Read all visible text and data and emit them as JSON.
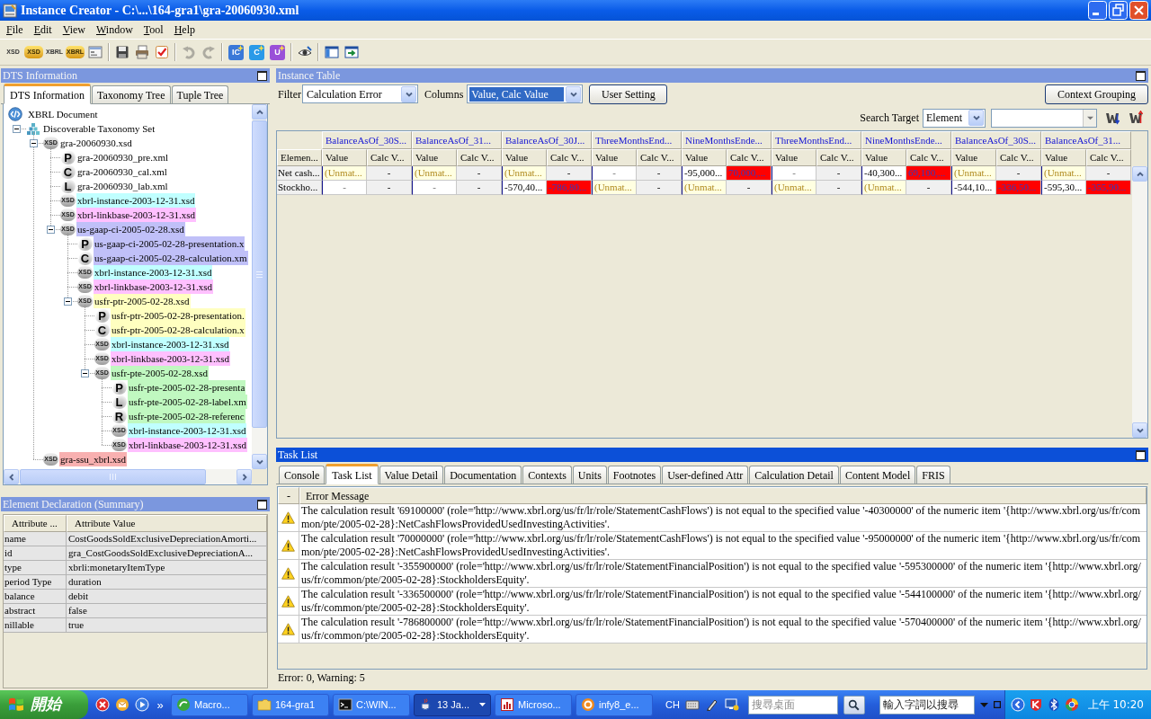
{
  "window": {
    "title": "Instance Creator - C:\\...\\164-gra1\\gra-20060930.xml"
  },
  "menu": [
    "File",
    "Edit",
    "View",
    "Window",
    "Tool",
    "Help"
  ],
  "toolbar": [
    {
      "kind": "text",
      "label": "XSD",
      "highlight": false,
      "disabled": false
    },
    {
      "kind": "text",
      "label": "XSD",
      "highlight": true,
      "disabled": false
    },
    {
      "kind": "text",
      "label": "XBRL",
      "highlight": false,
      "disabled": false
    },
    {
      "kind": "text",
      "label": "XBRL",
      "highlight": true,
      "disabled": false
    },
    {
      "kind": "icon",
      "disabled": false
    },
    {
      "kind": "separator"
    },
    {
      "kind": "icon",
      "disabled": false
    },
    {
      "kind": "icon",
      "disabled": false
    },
    {
      "kind": "icon",
      "disabled": false
    },
    {
      "kind": "separator"
    },
    {
      "kind": "icon",
      "disabled": true
    },
    {
      "kind": "icon",
      "disabled": true
    },
    {
      "kind": "separator"
    },
    {
      "kind": "tile",
      "label": "IC",
      "color": "#3a78d8",
      "disabled": false
    },
    {
      "kind": "tile",
      "label": "C",
      "color": "#2a9ae8",
      "disabled": false
    },
    {
      "kind": "tile",
      "label": "U",
      "color": "#9a50d8",
      "disabled": false
    },
    {
      "kind": "separator"
    },
    {
      "kind": "icon",
      "disabled": false
    },
    {
      "kind": "separator"
    },
    {
      "kind": "icon",
      "disabled": false
    },
    {
      "kind": "icon",
      "disabled": false
    }
  ],
  "dts_panel": {
    "title": "DTS Information",
    "active": false,
    "tabs": [
      {
        "label": "DTS Information",
        "selected": true
      },
      {
        "label": "Taxonomy Tree",
        "selected": false
      },
      {
        "label": "Tuple Tree",
        "selected": false
      }
    ],
    "tree": [
      {
        "label": "XBRL Document",
        "kind": "document",
        "children": [
          {
            "label": "Discoverable Taxonomy Set",
            "kind": "taxonomy",
            "expanded": true,
            "children": [
              {
                "label": "gra-20060930.xsd",
                "kind": "xsd",
                "badge": "XSD",
                "expanded": true,
                "children": [
                  {
                    "label": "gra-20060930_pre.xml",
                    "kind": "linkbase",
                    "badge": "P"
                  },
                  {
                    "label": "gra-20060930_cal.xml",
                    "kind": "linkbase",
                    "badge": "C"
                  },
                  {
                    "label": "gra-20060930_lab.xml",
                    "kind": "linkbase",
                    "badge": "L"
                  },
                  {
                    "label": "xbrl-instance-2003-12-31.xsd",
                    "kind": "xsd",
                    "badge": "XSD",
                    "color": "#c0ffff"
                  },
                  {
                    "label": "xbrl-linkbase-2003-12-31.xsd",
                    "kind": "xsd",
                    "badge": "XSD",
                    "color": "#ffc0ff"
                  },
                  {
                    "label": "us-gaap-ci-2005-02-28.xsd",
                    "kind": "xsd",
                    "badge": "XSD",
                    "color": "#c0c0f8",
                    "expanded": true,
                    "children": [
                      {
                        "label": "us-gaap-ci-2005-02-28-presentation.x",
                        "kind": "linkbase",
                        "badge": "P",
                        "color": "#c0c0f8"
                      },
                      {
                        "label": "us-gaap-ci-2005-02-28-calculation.xm",
                        "kind": "linkbase",
                        "badge": "C",
                        "color": "#c0c0f8"
                      },
                      {
                        "label": "xbrl-instance-2003-12-31.xsd",
                        "kind": "xsd",
                        "badge": "XSD",
                        "color": "#c0ffff"
                      },
                      {
                        "label": "xbrl-linkbase-2003-12-31.xsd",
                        "kind": "xsd",
                        "badge": "XSD",
                        "color": "#ffc0ff"
                      },
                      {
                        "label": "usfr-ptr-2005-02-28.xsd",
                        "kind": "xsd",
                        "badge": "XSD",
                        "color": "#ffffc0",
                        "expanded": true,
                        "children": [
                          {
                            "label": "usfr-ptr-2005-02-28-presentation.",
                            "kind": "linkbase",
                            "badge": "P",
                            "color": "#ffffc0"
                          },
                          {
                            "label": "usfr-ptr-2005-02-28-calculation.x",
                            "kind": "linkbase",
                            "badge": "C",
                            "color": "#ffffc0"
                          },
                          {
                            "label": "xbrl-instance-2003-12-31.xsd",
                            "kind": "xsd",
                            "badge": "XSD",
                            "color": "#c0ffff"
                          },
                          {
                            "label": "xbrl-linkbase-2003-12-31.xsd",
                            "kind": "xsd",
                            "badge": "XSD",
                            "color": "#ffc0ff"
                          },
                          {
                            "label": "usfr-pte-2005-02-28.xsd",
                            "kind": "xsd",
                            "badge": "XSD",
                            "color": "#c0f8c0",
                            "expanded": true,
                            "children": [
                              {
                                "label": "usfr-pte-2005-02-28-presenta",
                                "kind": "linkbase",
                                "badge": "P",
                                "color": "#c0f8c0"
                              },
                              {
                                "label": "usfr-pte-2005-02-28-label.xm",
                                "kind": "linkbase",
                                "badge": "L",
                                "color": "#c0f8c0"
                              },
                              {
                                "label": "usfr-pte-2005-02-28-referenc",
                                "kind": "linkbase",
                                "badge": "R",
                                "color": "#c0f8c0"
                              },
                              {
                                "label": "xbrl-instance-2003-12-31.xsd",
                                "kind": "xsd",
                                "badge": "XSD",
                                "color": "#c0ffff"
                              },
                              {
                                "label": "xbrl-linkbase-2003-12-31.xsd",
                                "kind": "xsd",
                                "badge": "XSD",
                                "color": "#ffc0ff"
                              }
                            ]
                          }
                        ]
                      }
                    ]
                  }
                ]
              },
              {
                "label": "gra-ssu_xbrl.xsd",
                "kind": "xsd",
                "badge": "XSD",
                "color": "#f8b0b0"
              }
            ]
          }
        ]
      }
    ]
  },
  "declaration_panel": {
    "title": "Element Declaration (Summary)",
    "active": false,
    "columns": [
      "Attribute ...",
      "Attribute Value"
    ],
    "rows": [
      {
        "attribute": "name",
        "value": "CostGoodsSoldExclusiveDepreciationAmorti..."
      },
      {
        "attribute": "id",
        "value": "gra_CostGoodsSoldExclusiveDepreciationA..."
      },
      {
        "attribute": "type",
        "value": "xbrli:monetaryItemType"
      },
      {
        "attribute": "period Type",
        "value": "duration"
      },
      {
        "attribute": "balance",
        "value": "debit"
      },
      {
        "attribute": "abstract",
        "value": "false"
      },
      {
        "attribute": "nillable",
        "value": "true"
      }
    ]
  },
  "instance_panel": {
    "title": "Instance Table",
    "active": false,
    "filter": {
      "label": "Filter",
      "value": "Calculation Error",
      "focused": false
    },
    "columns_select": {
      "label": "Columns",
      "value": "Value, Calc Value",
      "focused": true
    },
    "user_setting_button": "User Setting",
    "context_grouping_button": "Context Grouping",
    "search": {
      "label": "Search Target",
      "target": "Element"
    },
    "table": {
      "row_header": "Elemen...",
      "groups": [
        {
          "label": "BalanceAsOf_30S...",
          "columns": [
            "Value",
            "Calc V..."
          ]
        },
        {
          "label": "BalanceAsOf_31...",
          "columns": [
            "Value",
            "Calc V..."
          ]
        },
        {
          "label": "BalanceAsOf_30J...",
          "columns": [
            "Value",
            "Calc V..."
          ]
        },
        {
          "label": "ThreeMonthsEnd...",
          "columns": [
            "Value",
            "Calc V..."
          ]
        },
        {
          "label": "NineMonthsEnde...",
          "columns": [
            "Value",
            "Calc V..."
          ]
        },
        {
          "label": "ThreeMonthsEnd...",
          "columns": [
            "Value",
            "Calc V..."
          ]
        },
        {
          "label": "NineMonthsEnde...",
          "columns": [
            "Value",
            "Calc V..."
          ]
        },
        {
          "label": "BalanceAsOf_30S...",
          "columns": [
            "Value",
            "Calc V..."
          ]
        },
        {
          "label": "BalanceAsOf_31...",
          "columns": [
            "Value",
            "Calc V..."
          ]
        }
      ],
      "rows": [
        {
          "label": "Net cash...",
          "cells": [
            {
              "text": "(Unmat...",
              "kind": "unmatched"
            },
            {
              "text": "-",
              "kind": "empty"
            },
            {
              "text": "(Unmat...",
              "kind": "unmatched"
            },
            {
              "text": "-",
              "kind": "empty"
            },
            {
              "text": "(Unmat...",
              "kind": "unmatched"
            },
            {
              "text": "-",
              "kind": "empty"
            },
            {
              "text": "-",
              "kind": "empty"
            },
            {
              "text": "-",
              "kind": "empty"
            },
            {
              "text": "-95,000...",
              "kind": "value"
            },
            {
              "text": "70,000,...",
              "kind": "error"
            },
            {
              "text": "-",
              "kind": "empty"
            },
            {
              "text": "-",
              "kind": "empty"
            },
            {
              "text": "-40,300...",
              "kind": "value"
            },
            {
              "text": "69,100,...",
              "kind": "error"
            },
            {
              "text": "(Unmat...",
              "kind": "unmatched"
            },
            {
              "text": "-",
              "kind": "empty"
            },
            {
              "text": "(Unmat...",
              "kind": "unmatched"
            },
            {
              "text": "-",
              "kind": "empty"
            }
          ]
        },
        {
          "label": "Stockho...",
          "cells": [
            {
              "text": "-",
              "kind": "empty"
            },
            {
              "text": "-",
              "kind": "empty"
            },
            {
              "text": "-",
              "kind": "empty"
            },
            {
              "text": "-",
              "kind": "empty"
            },
            {
              "text": "-570,40...",
              "kind": "value"
            },
            {
              "text": "-786,80...",
              "kind": "error"
            },
            {
              "text": "(Unmat...",
              "kind": "unmatched"
            },
            {
              "text": "-",
              "kind": "empty"
            },
            {
              "text": "(Unmat...",
              "kind": "unmatched"
            },
            {
              "text": "-",
              "kind": "empty"
            },
            {
              "text": "(Unmat...",
              "kind": "unmatched"
            },
            {
              "text": "-",
              "kind": "empty"
            },
            {
              "text": "(Unmat...",
              "kind": "unmatched"
            },
            {
              "text": "-",
              "kind": "empty"
            },
            {
              "text": "-544,10...",
              "kind": "value"
            },
            {
              "text": "-336,50...",
              "kind": "error"
            },
            {
              "text": "-595,30...",
              "kind": "value"
            },
            {
              "text": "-355,90...",
              "kind": "error"
            }
          ]
        }
      ]
    }
  },
  "task_panel": {
    "title": "Task List",
    "active": true,
    "tabs": [
      {
        "label": "Console",
        "selected": false
      },
      {
        "label": "Task List",
        "selected": true
      },
      {
        "label": "Value Detail",
        "selected": false
      },
      {
        "label": "Documentation",
        "selected": false
      },
      {
        "label": "Contexts",
        "selected": false
      },
      {
        "label": "Units",
        "selected": false
      },
      {
        "label": "Footnotes",
        "selected": false
      },
      {
        "label": "User-defined Attr",
        "selected": false
      },
      {
        "label": "Calculation Detail",
        "selected": false
      },
      {
        "label": "Content Model",
        "selected": false
      },
      {
        "label": "FRIS",
        "selected": false
      }
    ],
    "columns": [
      "-",
      "Error Message"
    ],
    "rows": [
      {
        "kind": "warning",
        "message": "The calculation result '69100000' (role='http://www.xbrl.org/us/fr/lr/role/StatementCashFlows') is not equal to the specified value '-40300000' of the numeric item '{http://www.xbrl.org/us/fr/common/pte/2005-02-28}:NetCashFlowsProvidedUsedInvestingActivities'."
      },
      {
        "kind": "warning",
        "message": "The calculation result '70000000' (role='http://www.xbrl.org/us/fr/lr/role/StatementCashFlows') is not equal to the specified value '-95000000' of the numeric item '{http://www.xbrl.org/us/fr/common/pte/2005-02-28}:NetCashFlowsProvidedUsedInvestingActivities'."
      },
      {
        "kind": "warning",
        "message": "The calculation result '-355900000' (role='http://www.xbrl.org/us/fr/lr/role/StatementFinancialPosition') is not equal to the specified value '-595300000' of the numeric item '{http://www.xbrl.org/us/fr/common/pte/2005-02-28}:StockholdersEquity'."
      },
      {
        "kind": "warning",
        "message": "The calculation result '-336500000' (role='http://www.xbrl.org/us/fr/lr/role/StatementFinancialPosition') is not equal to the specified value '-544100000' of the numeric item '{http://www.xbrl.org/us/fr/common/pte/2005-02-28}:StockholdersEquity'."
      },
      {
        "kind": "warning",
        "message": "The calculation result '-786800000' (role='http://www.xbrl.org/us/fr/lr/role/StatementFinancialPosition') is not equal to the specified value '-570400000' of the numeric item '{http://www.xbrl.org/us/fr/common/pte/2005-02-28}:StockholdersEquity'."
      }
    ],
    "status": "Error: 0, Warning: 5"
  },
  "taskbar": {
    "start": "開始",
    "more": "»",
    "tasks": [
      {
        "label": "Macro...",
        "active": false,
        "grouped": false
      },
      {
        "label": "164-gra1",
        "active": false,
        "grouped": false
      },
      {
        "label": "C:\\WIN...",
        "active": false,
        "grouped": false
      },
      {
        "label": "13 Ja...",
        "active": true,
        "grouped": true
      },
      {
        "label": "Microso...",
        "active": false,
        "grouped": false
      },
      {
        "label": "infy8_e...",
        "active": false,
        "grouped": false
      }
    ],
    "language": "CH",
    "desktop_search": {
      "placeholder": "搜尋桌面"
    },
    "web_search": {
      "placeholder": "輸入字詞以搜尋"
    },
    "clock": "上午 10:20"
  }
}
